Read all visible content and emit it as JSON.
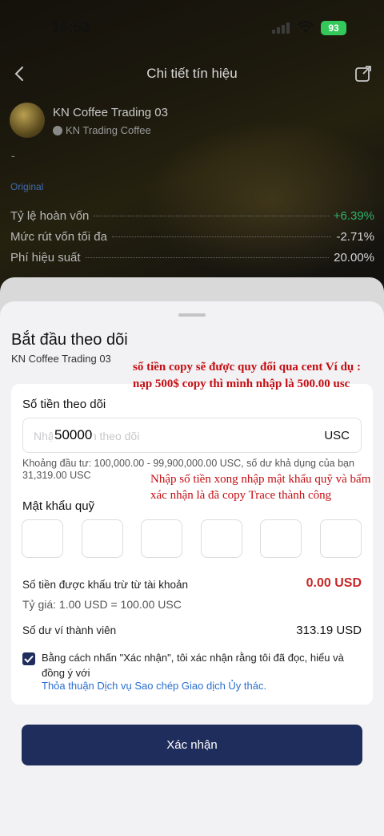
{
  "status_bar": {
    "time": "16:53",
    "battery": "93"
  },
  "nav": {
    "title": "Chi tiết tín hiệu"
  },
  "signal": {
    "name": "KN Coffee Trading 03",
    "author": "KN Trading Coffee",
    "dash": "-",
    "tag": "Original"
  },
  "stats": [
    {
      "label": "Tỷ lệ hoàn vốn",
      "value": "+6.39%"
    },
    {
      "label": "Mức rút vốn tối đa",
      "value": "-2.71%"
    },
    {
      "label": "Phí hiệu suất",
      "value": "20.00%"
    }
  ],
  "sheet": {
    "title": "Bắt đầu theo dõi",
    "subtitle": "KN Coffee Trading 03",
    "amount_label": "Số tiền theo dõi",
    "amount_placeholder": "Nhập số tiền theo dõi",
    "amount_value": "50000",
    "amount_unit": "USC",
    "invest_range": "Khoảng đầu tư: 100,000.00 - 99,900,000.00 USC, số dư khả dụng của bạn 31,319.00 USC",
    "password_label": "Mật khẩu quỹ",
    "deduct_label": "Số tiền được khấu trừ từ tài khoản",
    "deduct_value": "0.00 USD",
    "rate": "Tỷ giá: 1.00 USD = 100.00 USC",
    "wallet_label": "Số dư ví thành viên",
    "wallet_value": "313.19 USD",
    "agree_text": "Bằng cách nhấn \"Xác nhận\", tôi xác nhận rằng tôi đã đọc, hiểu và đồng ý với",
    "agree_link": "Thỏa thuận Dịch vụ Sao chép Giao dịch Ủy thác.",
    "confirm_label": "Xác nhận"
  },
  "annotations": {
    "note1": "số tiền copy sẽ được quy đổi qua cent Ví dụ : nạp 500$ copy thì mình nhập là 500.00 usc",
    "note2": "Nhập số tiền xong nhập mật khẩu quỹ và bấm xác nhận là đã copy Trace thành công"
  },
  "colors": {
    "primary": "#1f2d5c",
    "link": "#2a6fcf",
    "danger": "#c62828",
    "positive": "#2fb36a",
    "annotation": "#c40d12"
  }
}
